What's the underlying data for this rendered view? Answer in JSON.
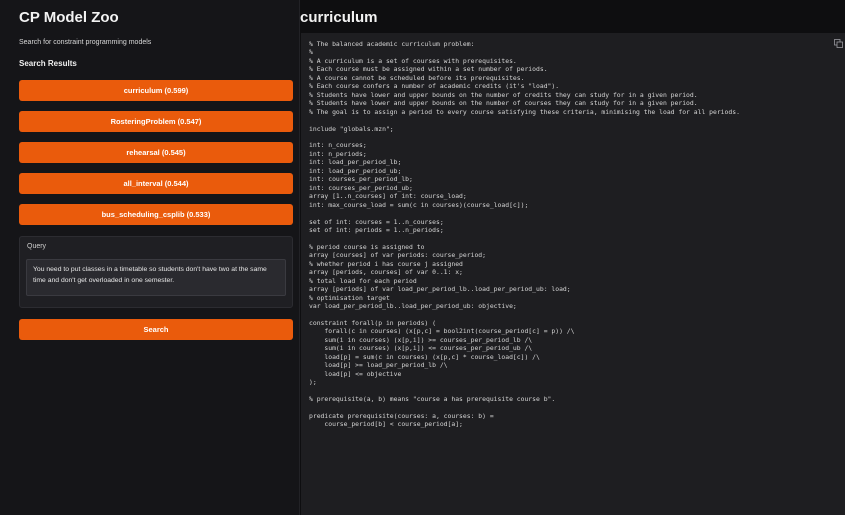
{
  "sidebar": {
    "app_title": "CP Model Zoo",
    "subtitle": "Search for constraint programming models",
    "results_heading": "Search Results",
    "results": [
      {
        "label": "curriculum (0.599)"
      },
      {
        "label": "RosteringProblem (0.547)"
      },
      {
        "label": "rehearsal (0.545)"
      },
      {
        "label": "all_interval (0.544)"
      },
      {
        "label": "bus_scheduling_csplib (0.533)"
      }
    ],
    "query": {
      "label": "Query",
      "value": "You need to put classes in a timetable so students don't have two at the same time and don't get overloaded in one semester."
    },
    "search_label": "Search"
  },
  "main": {
    "title": "curriculum",
    "copy_icon": "copy-icon",
    "code": "% The balanced academic curriculum problem:\n%\n% A curriculum is a set of courses with prerequisites.\n% Each course must be assigned within a set number of periods.\n% A course cannot be scheduled before its prerequisites.\n% Each course confers a number of academic credits (it's \"load\").\n% Students have lower and upper bounds on the number of credits they can study for in a given period.\n% Students have lower and upper bounds on the number of courses they can study for in a given period.\n% The goal is to assign a period to every course satisfying these criteria, minimising the load for all periods.\n\ninclude \"globals.mzn\";\n\nint: n_courses;\nint: n_periods;\nint: load_per_period_lb;\nint: load_per_period_ub;\nint: courses_per_period_lb;\nint: courses_per_period_ub;\narray [1..n_courses] of int: course_load;\nint: max_course_load = sum(c in courses)(course_load[c]);\n\nset of int: courses = 1..n_courses;\nset of int: periods = 1..n_periods;\n\n% period course is assigned to\narray [courses] of var periods: course_period;\n% whether period i has course j assigned\narray [periods, courses] of var 0..1: x;\n% total load for each period\narray [periods] of var load_per_period_lb..load_per_period_ub: load;\n% optimisation target\nvar load_per_period_lb..load_per_period_ub: objective;\n\nconstraint forall(p in periods) (\n    forall(c in courses) (x[p,c] = bool2int(course_period[c] = p)) /\\\n    sum(i in courses) (x[p,i]) >= courses_per_period_lb /\\\n    sum(i in courses) (x[p,i]) <= courses_per_period_ub /\\\n    load[p] = sum(c in courses) (x[p,c] * course_load[c]) /\\\n    load[p] >= load_per_period_lb /\\\n    load[p] <= objective\n);\n\n% prerequisite(a, b) means \"course a has prerequisite course b\".\n\npredicate prerequisite(courses: a, courses: b) =\n    course_period[b] < course_period[a];"
  },
  "colors": {
    "accent": "#ea5b0c",
    "background": "#0e0e10",
    "sidebar": "#151518",
    "code_bg": "#1e1e21"
  }
}
